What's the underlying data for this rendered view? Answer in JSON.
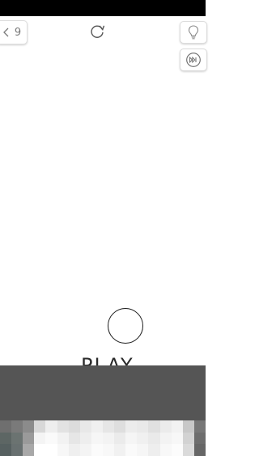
{
  "header": {
    "level_number": "9",
    "back_icon": "chevron-left-icon",
    "restart_icon": "restart-icon"
  },
  "side_buttons": {
    "hint_icon": "lightbulb-icon",
    "skip_icon": "skip-forward-icon"
  },
  "game": {
    "play_label": "PLAY"
  },
  "colors": {
    "background": "#ffffff",
    "icon_gray": "#7a7a7a",
    "ad_overlay": "#555555"
  }
}
